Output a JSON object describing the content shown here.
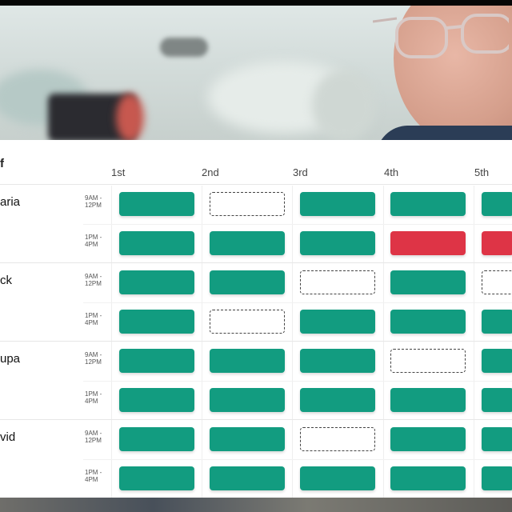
{
  "header": {
    "title": "f"
  },
  "days": [
    "1st",
    "2nd",
    "3rd",
    "4th",
    "5th"
  ],
  "staff": [
    {
      "name": "aria",
      "shifts": [
        {
          "time": "9AM - 12PM",
          "slots": [
            "available",
            "open",
            "available",
            "available",
            "available"
          ]
        },
        {
          "time": "1PM - 4PM",
          "slots": [
            "available",
            "available",
            "available",
            "booked",
            "booked"
          ]
        }
      ]
    },
    {
      "name": "ck",
      "shifts": [
        {
          "time": "9AM - 12PM",
          "slots": [
            "available",
            "available",
            "open",
            "available",
            "open"
          ]
        },
        {
          "time": "1PM - 4PM",
          "slots": [
            "available",
            "open",
            "available",
            "available",
            "available"
          ]
        }
      ]
    },
    {
      "name": "upa",
      "shifts": [
        {
          "time": "9AM - 12PM",
          "slots": [
            "available",
            "available",
            "available",
            "open",
            "available"
          ]
        },
        {
          "time": "1PM - 4PM",
          "slots": [
            "available",
            "available",
            "available",
            "available",
            "available"
          ]
        }
      ]
    },
    {
      "name": "vid",
      "shifts": [
        {
          "time": "9AM - 12PM",
          "slots": [
            "available",
            "available",
            "open",
            "available",
            "available"
          ]
        },
        {
          "time": "1PM - 4PM",
          "slots": [
            "available",
            "available",
            "available",
            "available",
            "available"
          ]
        }
      ]
    }
  ],
  "colors": {
    "available": "#129c80",
    "booked": "#de3446",
    "open": "#ffffff"
  }
}
